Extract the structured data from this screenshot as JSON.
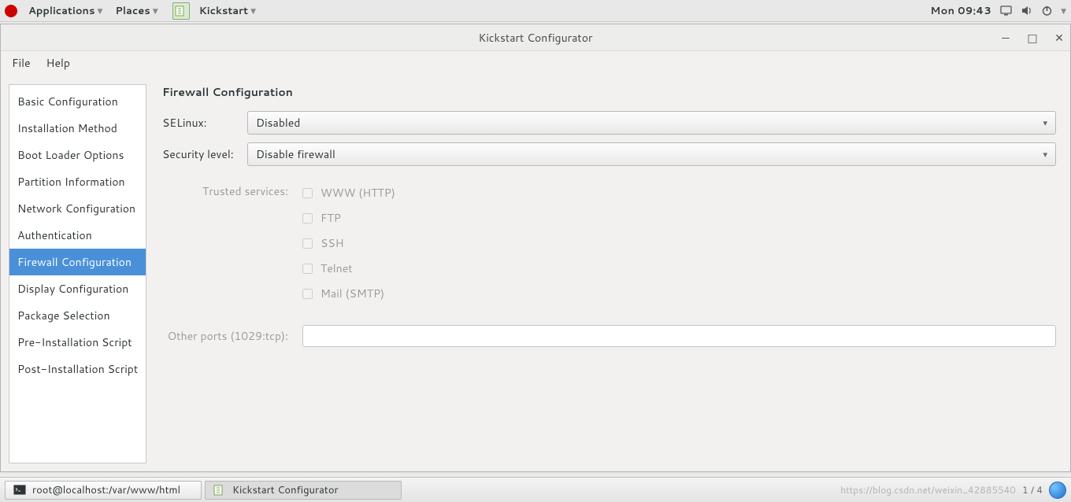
{
  "panel": {
    "menus": {
      "applications": "Applications",
      "places": "Places",
      "kickstart": "Kickstart"
    },
    "clock": "Mon 09:43"
  },
  "window": {
    "title": "Kickstart Configurator",
    "menubar": {
      "file": "File",
      "help": "Help"
    },
    "sidebar": {
      "items": [
        {
          "label": "Basic Configuration"
        },
        {
          "label": "Installation Method"
        },
        {
          "label": "Boot Loader Options"
        },
        {
          "label": "Partition Information"
        },
        {
          "label": "Network Configuration"
        },
        {
          "label": "Authentication"
        },
        {
          "label": "Firewall Configuration"
        },
        {
          "label": "Display Configuration"
        },
        {
          "label": "Package Selection"
        },
        {
          "label": "Pre-Installation Script"
        },
        {
          "label": "Post-Installation Script"
        }
      ],
      "selected_index": 6
    },
    "pane": {
      "heading": "Firewall Configuration",
      "selinux": {
        "label": "SELinux:",
        "value": "Disabled"
      },
      "security_level": {
        "label": "Security level:",
        "value": "Disable firewall"
      },
      "trusted": {
        "label": "Trusted services:",
        "items": [
          {
            "label": "WWW (HTTP)",
            "checked": false
          },
          {
            "label": "FTP",
            "checked": false
          },
          {
            "label": "SSH",
            "checked": false
          },
          {
            "label": "Telnet",
            "checked": false
          },
          {
            "label": "Mail (SMTP)",
            "checked": false
          }
        ]
      },
      "other_ports": {
        "label": "Other ports (1029:tcp):",
        "value": ""
      }
    }
  },
  "taskbar": {
    "items": [
      {
        "label": "root@localhost:/var/www/html"
      },
      {
        "label": "Kickstart Configurator"
      }
    ],
    "page_indicator": "1 / 4",
    "watermark": "https://blog.csdn.net/weixin_42885540"
  }
}
